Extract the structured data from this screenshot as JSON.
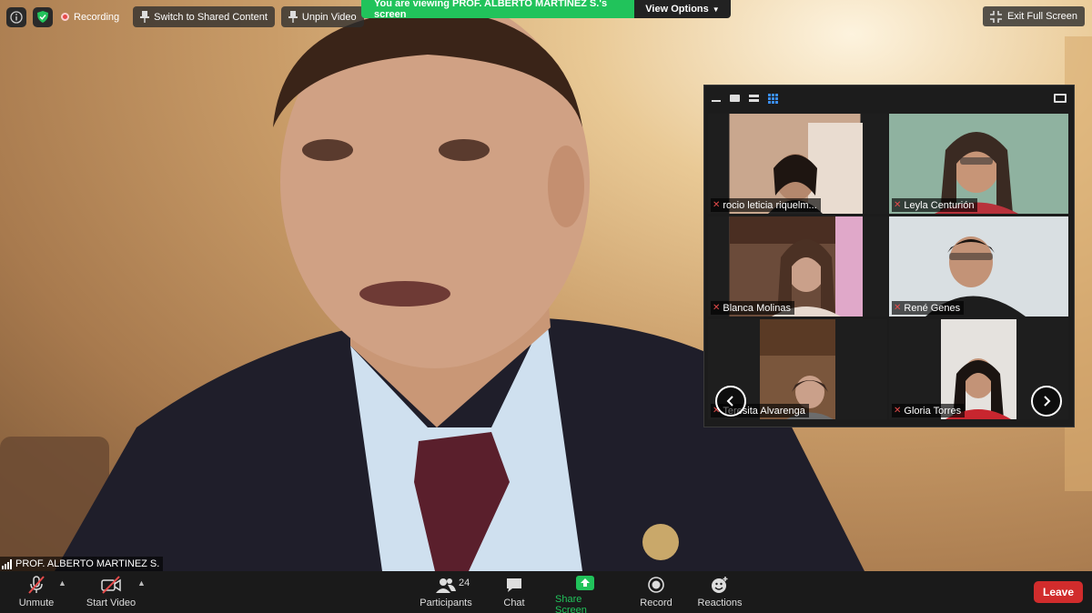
{
  "top_bar": {
    "recording_label": "Recording",
    "switch_label": "Switch to Shared Content",
    "unpin_label": "Unpin Video",
    "banner_text": "You are viewing PROF. ALBERTO MARTINEZ S.'s screen",
    "view_options_label": "View Options",
    "exit_fullscreen_label": "Exit Full Screen"
  },
  "main_video": {
    "speaker_name": "PROF. ALBERTO MARTINEZ S."
  },
  "gallery": {
    "participants": [
      {
        "name": "rocio leticia riquelm..."
      },
      {
        "name": "Leyla Centurión"
      },
      {
        "name": "Blanca Molinas"
      },
      {
        "name": "René Genes"
      },
      {
        "name": "Teresita Alvarenga"
      },
      {
        "name": "Gloria Torres"
      }
    ]
  },
  "bottom_bar": {
    "unmute_label": "Unmute",
    "start_video_label": "Start Video",
    "participants_label": "Participants",
    "participants_count": "24",
    "chat_label": "Chat",
    "share_screen_label": "Share Screen",
    "record_label": "Record",
    "reactions_label": "Reactions",
    "leave_label": "Leave"
  },
  "colors": {
    "banner_green": "#21c35b",
    "share_green": "#21c35b",
    "leave_red": "#d12c2c",
    "muted_red": "#e54b4b"
  }
}
